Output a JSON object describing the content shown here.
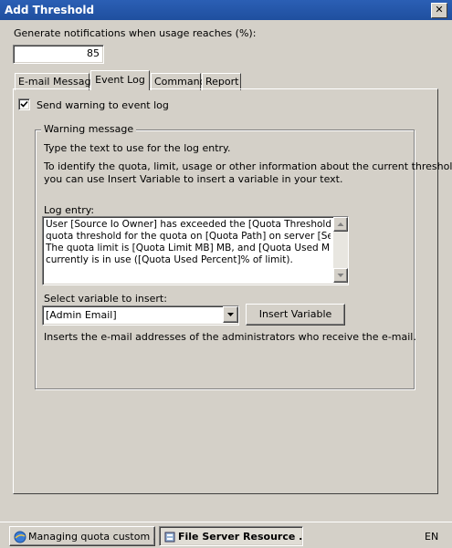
{
  "window": {
    "title": "Add Threshold",
    "close_glyph": "✕"
  },
  "threshold": {
    "label": "Generate notifications when usage reaches (%):",
    "value": "85"
  },
  "tabs": [
    {
      "label": "E-mail Message",
      "active": false
    },
    {
      "label": "Event Log",
      "active": true
    },
    {
      "label": "Command",
      "active": false
    },
    {
      "label": "Report",
      "active": false
    }
  ],
  "event_log": {
    "checkbox_label": "Send warning to event log",
    "checked": true,
    "group_title": "Warning message",
    "instruction": "Type the text to use for the log entry.",
    "help_line1": "To identify the quota, limit, usage or other information about the current threshold,",
    "help_line2": "you can use Insert Variable to insert a variable in your text.",
    "log_entry_label": "Log entry:",
    "log_entry_lines": [
      "User [Source Io Owner] has exceeded the [Quota Threshold]%",
      "quota threshold for the quota on [Quota Path] on server [Server].",
      "The quota limit is [Quota Limit MB] MB, and [Quota Used MB] MB",
      "currently is in use ([Quota Used Percent]% of limit)."
    ],
    "variable_label": "Select variable to insert:",
    "variable_selected": "[Admin Email]",
    "insert_button": "Insert Variable",
    "variable_description": "Inserts the e-mail addresses of the administrators who receive the e-mail."
  },
  "taskbar": {
    "items": [
      {
        "label": "Managing quota custom ...",
        "icon": "browser-icon",
        "active": false
      },
      {
        "label": "File Server Resource ...",
        "icon": "fsrm-icon",
        "active": true
      }
    ],
    "language": "EN"
  },
  "colors": {
    "title_bar": "#1f4f9f",
    "dialog_bg": "#d4d0c8"
  }
}
